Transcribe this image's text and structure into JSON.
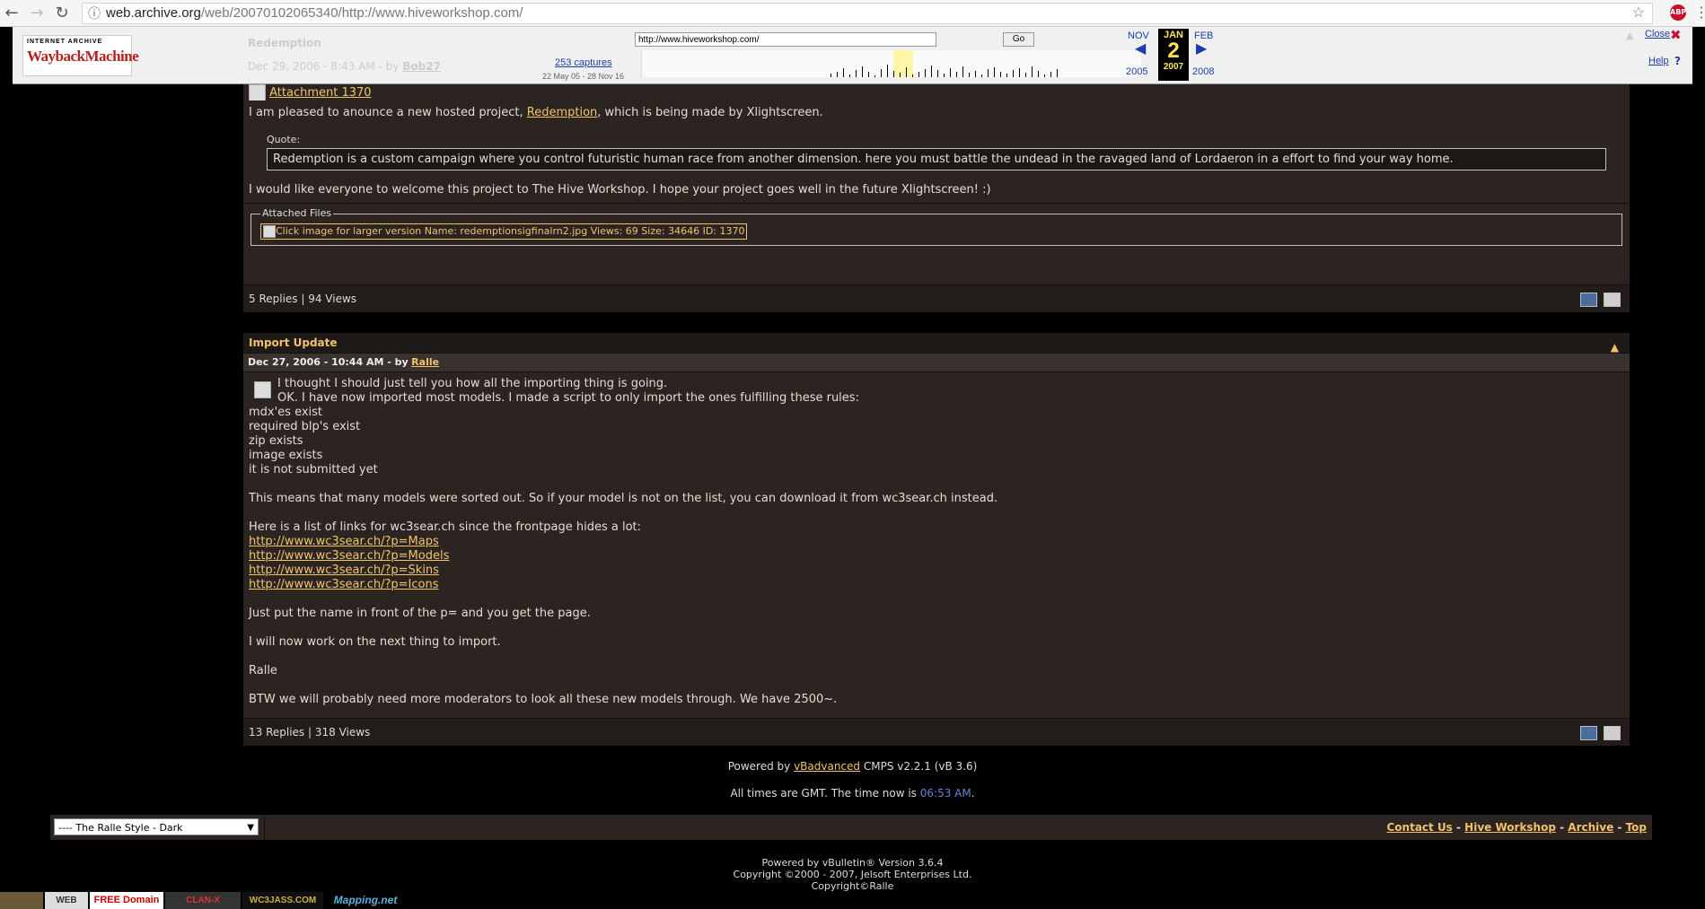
{
  "browser": {
    "back_icon": "arrow-left-icon",
    "forward_icon": "arrow-right-icon",
    "reload_icon": "reload-icon",
    "url_host": "web.archive.org",
    "url_path": "/web/20070102065340/http://www.hiveworkshop.com/",
    "star_icon": "star-icon",
    "extension_badge": "ABP",
    "menu_icon": "more-vertical-icon"
  },
  "wayback": {
    "logo_top": "INTERNET ARCHIVE",
    "logo_main": "WaybackMachine",
    "url_value": "http://www.hiveworkshop.com/",
    "go_label": "Go",
    "captures_link": "253 captures",
    "capture_range": "22 May 05 - 28 Nov 16",
    "prev_month": "NOV",
    "prev_year": "2005",
    "cur_month": "JAN",
    "cur_day": "2",
    "cur_year": "2007",
    "next_month": "FEB",
    "next_year": "2008",
    "close_label": "Close",
    "help_label": "Help",
    "overlay_title": "Redemption",
    "overlay_date": "Dec 29, 2006 - 8:43 AM - by",
    "overlay_author": "Bob27"
  },
  "post1": {
    "attachment_link": "Attachment 1370",
    "intro_before": "I am pleased to anounce a new hosted project, ",
    "intro_link": "Redemption",
    "intro_after": ", which is being made by Xlightscreen.",
    "quote_label": "Quote:",
    "quote_text": "Redemption is a custom campaign where you control futuristic human race from another dimension. here you must battle the undead in the ravaged land of Lordaeron in a effort to find your way home.",
    "welcome": "I would like everyone to welcome this project to The Hive Workshop. I hope your project goes well in the future Xlightscreen! :)",
    "attached_label": "Attached Files",
    "attached_file": "Click image for larger version Name: redemptionsigfinalrn2.jpg Views: 69 Size: 34646 ID: 1370",
    "stats": "5 Replies | 94 Views"
  },
  "post2": {
    "title": "Import Update",
    "date": "Dec 27, 2006 - 10:44 AM - by",
    "author": "Ralle",
    "line1": "I thought I should just tell you how all the importing thing is going.",
    "line2": "OK. I have now imported most models. I made a script to only import the ones fulfilling these rules:",
    "rules": [
      "mdx'es exist",
      "required blp's exist",
      "zip exists",
      "image exists",
      "it is not submitted yet"
    ],
    "sorted": "This means that many models were sorted out. So if your model is not on the list, you can download it from wc3sear.ch instead.",
    "links_intro": "Here is a list of links for wc3sear.ch since the frontpage hides a lot:",
    "links": [
      "http://www.wc3sear.ch/?p=Maps",
      "http://www.wc3sear.ch/?p=Models",
      "http://www.wc3sear.ch/?p=Skins",
      "http://www.wc3sear.ch/?p=Icons"
    ],
    "put_name": "Just put the name in front of the p= and you get the page.",
    "next_thing": "I will now work on the next thing to import.",
    "sign": "Ralle",
    "btw": "BTW we will probably need more moderators to look all these new models through. We have 2500~.",
    "stats": "13 Replies | 318 Views"
  },
  "footer": {
    "powered_before": "Powered by ",
    "powered_link": "vBadvanced",
    "powered_after": " CMPS v2.2.1 (vB 3.6)",
    "times_before": "All times are GMT. The time now is ",
    "times_value": "06:53 AM",
    "times_after": ".",
    "style_select": "---- The Ralle Style - Dark",
    "links": [
      "Contact Us",
      "Hive Workshop",
      "Archive",
      "Top"
    ],
    "link_sep": " - ",
    "vb_line1": "Powered by vBulletin® Version 3.6.4",
    "vb_line2": "Copyright ©2000 - 2007, Jelsoft Enterprises Ltd.",
    "vb_line3": "Copyright©Ralle"
  },
  "banners": [
    "WEB",
    "FREE Domain",
    "CLAN-X",
    "WC3JASS.COM",
    "Mapping.net"
  ]
}
